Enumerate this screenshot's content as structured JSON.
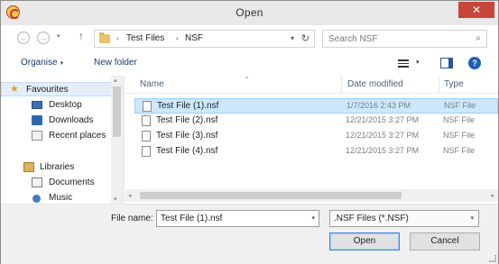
{
  "window": {
    "title": "Open",
    "close_glyph": "✕",
    "app_icon": "app-logo-icon"
  },
  "nav": {
    "back_glyph": "←",
    "forward_glyph": "→",
    "history_glyph": "▾",
    "up_glyph": "↑",
    "breadcrumbs": [
      "Test Files",
      "NSF"
    ],
    "breadcrumb_sep": "›",
    "address_dropdown": "▾",
    "refresh_glyph": "↻",
    "search_placeholder": "Search NSF",
    "search_glyph": "⌕"
  },
  "toolbar": {
    "organise_label": "Organise",
    "organise_caret": "▾",
    "new_folder_label": "New folder",
    "view_caret": "▾",
    "help_label": "?"
  },
  "sidebar": {
    "items": [
      {
        "label": "Favourites",
        "icon": "star-icon",
        "glyph": "★"
      },
      {
        "label": "Desktop",
        "icon": "desktop-icon"
      },
      {
        "label": "Downloads",
        "icon": "downloads-icon"
      },
      {
        "label": "Recent places",
        "icon": "recent-places-icon"
      },
      {
        "label": "Libraries",
        "icon": "libraries-icon"
      },
      {
        "label": "Documents",
        "icon": "documents-icon"
      },
      {
        "label": "Music",
        "icon": "music-icon"
      }
    ],
    "scroll_up": "▴",
    "scroll_down": "▾"
  },
  "files": {
    "columns": {
      "name": "Name",
      "date": "Date modified",
      "type": "Type"
    },
    "sort_glyph": "^",
    "rows": [
      {
        "name": "Test File (1).nsf",
        "date": "1/7/2016 2:43 PM",
        "type": "NSF File"
      },
      {
        "name": "Test File (2).nsf",
        "date": "12/21/2015 3:27 PM",
        "type": "NSF File"
      },
      {
        "name": "Test File (3).nsf",
        "date": "12/21/2015 3:27 PM",
        "type": "NSF File"
      },
      {
        "name": "Test File (4).nsf",
        "date": "12/21/2015 3:27 PM",
        "type": "NSF File"
      }
    ],
    "selected_index": 0,
    "hscroll_left": "◂",
    "hscroll_right": "▸"
  },
  "footer": {
    "file_name_label": "File name:",
    "file_name_value": "Test File (1).nsf",
    "file_name_caret": "▾",
    "file_type_value": ".NSF Files (*.NSF)",
    "file_type_caret": "▾",
    "open_label": "Open",
    "cancel_label": "Cancel"
  },
  "colors": {
    "selection": "#cce8ff",
    "accent": "#1f5fb0",
    "close": "#c7463c"
  }
}
